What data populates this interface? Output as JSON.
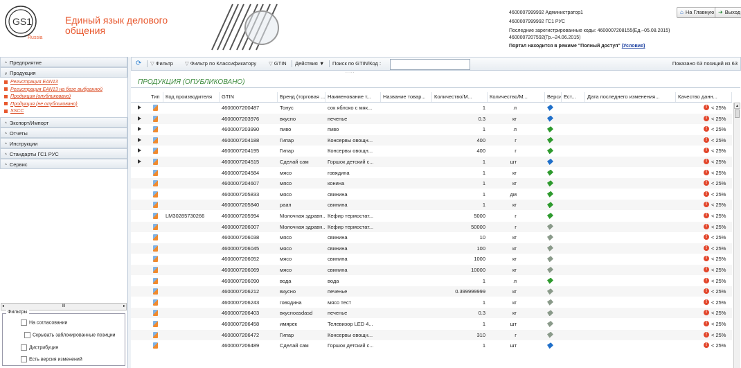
{
  "header": {
    "tagline": "Единый язык делового общения",
    "logo_text": "GS1",
    "logo_sub": "Russia",
    "user_line": "4600007999992 Администратор1",
    "org_line": "4600007999992 ГС1 РУС",
    "last_codes_line1": "Последние зарегистрированные коды: 4600007208155(Ед.–05.08.2015)",
    "last_codes_line2": "4600007207592(Гр.–24.06.2015)",
    "portal_mode": "Портал находится в режиме \"Полный доступ\"",
    "portal_mode_link": "(Условия)",
    "home_button": "На Главную",
    "logout_button": "Выход"
  },
  "sidebar": {
    "sections": [
      {
        "label": "Предприятие",
        "arrow": "^"
      },
      {
        "label": "Продукция",
        "arrow": "v"
      }
    ],
    "tree": [
      "Регистрация EAN13",
      "Регистрация EAN13 на базе выбранной",
      "Продукция (опубликовано)",
      "Продукция (не опубликовано)",
      "SSCC"
    ],
    "sections_after": [
      {
        "label": "Экспорт/Импорт"
      },
      {
        "label": "Отчеты"
      },
      {
        "label": "Инструкции"
      },
      {
        "label": "Стандарты ГС1 РУС"
      },
      {
        "label": "Сервис"
      }
    ],
    "scroll_mid": "III"
  },
  "filters": {
    "legend": "Фильтры",
    "items": [
      "На согласовании",
      "Скрывать заблокированные позиции",
      "Дистрибуция",
      "Есть версия изменений"
    ]
  },
  "toolbar": {
    "filter": "Фильтр",
    "filter_classifier": "Фильтр по Классификатору",
    "gtin": "GTIN",
    "actions": "Действия ▼",
    "search_label": "Поиск по GTIN/Код :",
    "search_value": "",
    "shown": "Показано 63 позиций из 63",
    "dots": "....."
  },
  "grid": {
    "title": "ПРОДУКЦИЯ (ОПУБЛИКОВАНО)",
    "columns": [
      "Тип",
      "Код производителя",
      "GTIN",
      "Бренд (торговая ...",
      "Наименование т...",
      "Название товар...",
      "Количество/М...",
      "Количество/М...",
      "Версии",
      "Ест...",
      "Дата последнего изменения...",
      "Качество данн..."
    ],
    "rows": [
      {
        "exp": true,
        "code": "",
        "gtin": "4600007200487",
        "brand": "Тонус",
        "name": "сок яблоко с мяк...",
        "qty": "1",
        "unit": "л",
        "ver": "blue",
        "q": "< 25%"
      },
      {
        "exp": true,
        "code": "",
        "gtin": "4600007203976",
        "brand": "вкусно",
        "name": "печенье",
        "qty": "0.3",
        "unit": "кг",
        "ver": "blue",
        "q": "< 25%"
      },
      {
        "exp": true,
        "code": "",
        "gtin": "4600007203990",
        "brand": "пиво",
        "name": "пиво",
        "qty": "1",
        "unit": "л",
        "ver": "green",
        "q": "< 25%"
      },
      {
        "exp": true,
        "code": "",
        "gtin": "4600007204188",
        "brand": "Гипар",
        "name": "Консервы овощн...",
        "qty": "400",
        "unit": "г",
        "ver": "green",
        "q": "< 25%"
      },
      {
        "exp": true,
        "code": "",
        "gtin": "4600007204195",
        "brand": "Гипар",
        "name": "Консервы овощн...",
        "qty": "400",
        "unit": "г",
        "ver": "green",
        "q": "< 25%"
      },
      {
        "exp": true,
        "code": "",
        "gtin": "4600007204515",
        "brand": "Сделай сам",
        "name": "Горшок детский с...",
        "qty": "1",
        "unit": "шт",
        "ver": "blue",
        "q": "< 25%"
      },
      {
        "exp": false,
        "code": "",
        "gtin": "4600007204584",
        "brand": "мясо",
        "name": "говядина",
        "qty": "1",
        "unit": "кг",
        "ver": "green",
        "q": "< 25%"
      },
      {
        "exp": false,
        "code": "",
        "gtin": "4600007204607",
        "brand": "мясо",
        "name": "конина",
        "qty": "1",
        "unit": "кг",
        "ver": "green",
        "q": "< 25%"
      },
      {
        "exp": false,
        "code": "",
        "gtin": "4600007205833",
        "brand": "мясо",
        "name": "свинина",
        "qty": "1",
        "unit": "дм",
        "ver": "green",
        "q": "< 25%"
      },
      {
        "exp": false,
        "code": "",
        "gtin": "4600007205840",
        "brand": "раап",
        "name": "свинина",
        "qty": "1",
        "unit": "кг",
        "ver": "green",
        "q": "< 25%"
      },
      {
        "exp": false,
        "code": "LM30285730266",
        "gtin": "4600007205994",
        "brand": "Молочная здравн...",
        "name": "Кефир термостат...",
        "qty": "5000",
        "unit": "г",
        "ver": "green",
        "q": "< 25%"
      },
      {
        "exp": false,
        "code": "",
        "gtin": "4600007206007",
        "brand": "Молочная здравн...",
        "name": "Кефир термостат...",
        "qty": "50000",
        "unit": "г",
        "ver": "grey",
        "q": "< 25%"
      },
      {
        "exp": false,
        "code": "",
        "gtin": "4600007206038",
        "brand": "мясо",
        "name": "свинина",
        "qty": "10",
        "unit": "кг",
        "ver": "grey",
        "q": "< 25%"
      },
      {
        "exp": false,
        "code": "",
        "gtin": "4600007206045",
        "brand": "мясо",
        "name": "свинина",
        "qty": "100",
        "unit": "кг",
        "ver": "grey",
        "q": "< 25%"
      },
      {
        "exp": false,
        "code": "",
        "gtin": "4600007206052",
        "brand": "мясо",
        "name": "свинина",
        "qty": "1000",
        "unit": "кг",
        "ver": "grey",
        "q": "< 25%"
      },
      {
        "exp": false,
        "code": "",
        "gtin": "4600007206069",
        "brand": "мясо",
        "name": "свинина",
        "qty": "10000",
        "unit": "кг",
        "ver": "grey",
        "q": "< 25%"
      },
      {
        "exp": false,
        "code": "",
        "gtin": "4600007206090",
        "brand": "вода",
        "name": "вода",
        "qty": "1",
        "unit": "л",
        "ver": "green",
        "q": "< 25%"
      },
      {
        "exp": false,
        "code": "",
        "gtin": "4600007206212",
        "brand": "вкусно",
        "name": "печенье",
        "qty": "0.399999999",
        "unit": "кг",
        "ver": "grey",
        "q": "< 25%"
      },
      {
        "exp": false,
        "code": "",
        "gtin": "4600007206243",
        "brand": "говядина",
        "name": "мясо тест",
        "qty": "1",
        "unit": "кг",
        "ver": "grey",
        "q": "< 25%"
      },
      {
        "exp": false,
        "code": "",
        "gtin": "4600007206403",
        "brand": "вкусноasdasd",
        "name": "печенье",
        "qty": "0.3",
        "unit": "кг",
        "ver": "grey",
        "q": "< 25%"
      },
      {
        "exp": false,
        "code": "",
        "gtin": "4600007206458",
        "brand": "имярек",
        "name": "Телевизор LED 4...",
        "qty": "1",
        "unit": "шт",
        "ver": "grey",
        "q": "< 25%"
      },
      {
        "exp": false,
        "code": "",
        "gtin": "4600007206472",
        "brand": "Гипар",
        "name": "Консервы овощн...",
        "qty": "310",
        "unit": "г",
        "ver": "grey",
        "q": "< 25%"
      },
      {
        "exp": false,
        "code": "",
        "gtin": "4600007206489",
        "brand": "Сделай сам",
        "name": "Горшок детский с...",
        "qty": "1",
        "unit": "шт",
        "ver": "blue",
        "q": "< 25%"
      }
    ]
  },
  "colors": {
    "accent": "#e8582e",
    "title_green": "#3d8b3d",
    "ver_blue": "#1f6fc9",
    "ver_green": "#2e9a2e",
    "ver_grey": "#8a9a8a",
    "quality_red": "#e2452a"
  }
}
